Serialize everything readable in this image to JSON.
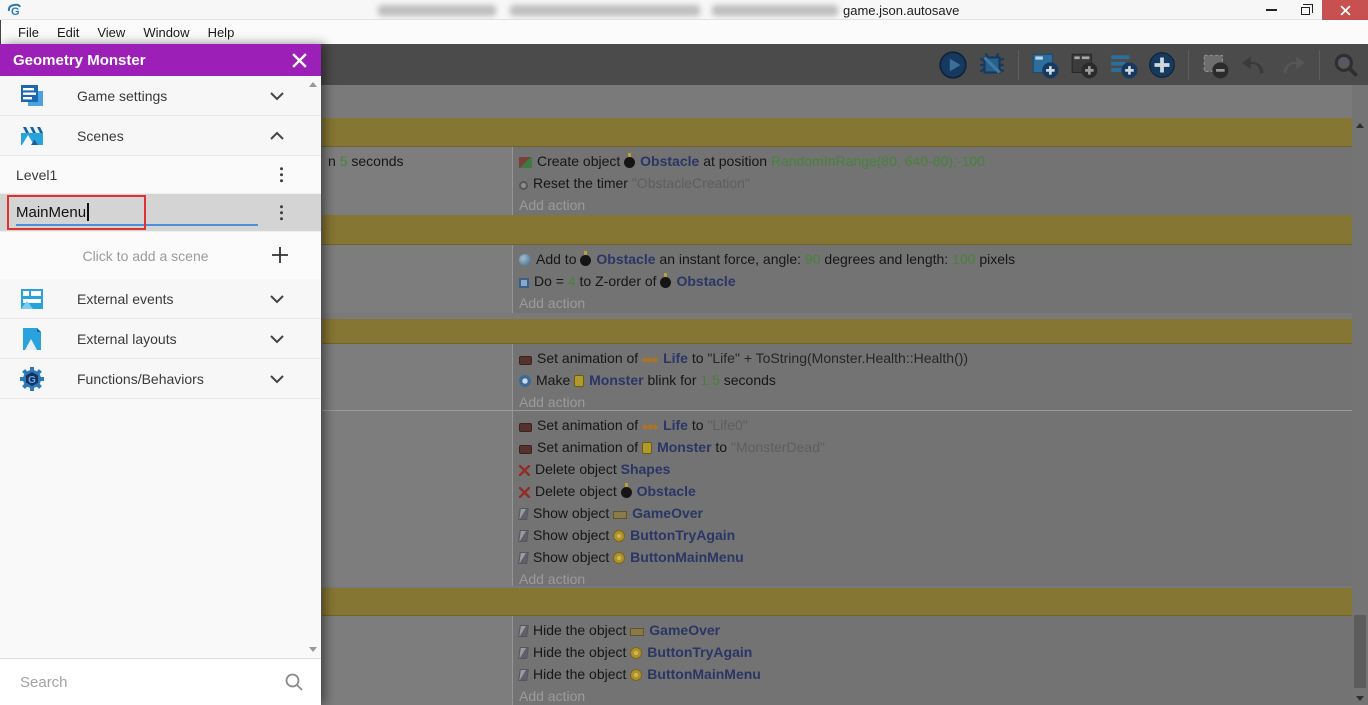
{
  "window": {
    "title": "game.json.autosave"
  },
  "menu": {
    "items": [
      "File",
      "Edit",
      "View",
      "Window",
      "Help"
    ]
  },
  "drawer": {
    "title": "Geometry Monster",
    "game_settings_label": "Game settings",
    "scenes_label": "Scenes",
    "scene_items": [
      {
        "name": "Level1"
      }
    ],
    "scene_edit_value": "MainMenu",
    "add_scene_label": "Click to add a scene",
    "external_events_label": "External events",
    "external_layouts_label": "External layouts",
    "functions_label": "Functions/Behaviors",
    "search_placeholder": "Search"
  },
  "toolbar": {
    "buttons": [
      {
        "name": "preview",
        "enabled": true
      },
      {
        "name": "debug",
        "enabled": true
      },
      {
        "name": "add-event",
        "enabled": true
      },
      {
        "name": "add-sub-event",
        "enabled": true
      },
      {
        "name": "add-comment",
        "enabled": true
      },
      {
        "name": "add-other-event",
        "enabled": true
      },
      {
        "name": "delete-event",
        "enabled": false
      },
      {
        "name": "undo",
        "enabled": false
      },
      {
        "name": "redo",
        "enabled": false
      },
      {
        "name": "search-events",
        "enabled": true
      }
    ]
  },
  "colors": {
    "accent_purple": "#9c1fb8",
    "comment_band": "#867633",
    "object_text": "#2b3566",
    "expression_text": "#47823a",
    "edit_underline": "#4a90d9",
    "annotation_red": "#df312e",
    "close_button_red": "#c75050"
  },
  "events": {
    "add_action_label": "Add action",
    "groups": [
      {
        "banner": true,
        "conditions": [
          [
            {
              "t": "p",
              "x": "n "
            },
            {
              "t": "e",
              "x": "5"
            },
            {
              "t": "p",
              "x": " seconds"
            }
          ]
        ],
        "actions": [
          [
            {
              "t": "i",
              "n": "create-object"
            },
            {
              "t": "p",
              "x": "Create object "
            },
            {
              "t": "i",
              "n": "bomb"
            },
            {
              "t": "o",
              "x": "Obstacle"
            },
            {
              "t": "p",
              "x": " at position "
            },
            {
              "t": "e",
              "x": "RandomInRange(80, 640-80);-100"
            }
          ],
          [
            {
              "t": "i",
              "n": "timer"
            },
            {
              "t": "p",
              "x": "Reset the timer "
            },
            {
              "t": "s",
              "x": "\"ObstacleCreation\""
            }
          ]
        ]
      },
      {
        "banner": true,
        "conditions": [],
        "actions": [
          [
            {
              "t": "i",
              "n": "force"
            },
            {
              "t": "p",
              "x": "Add to "
            },
            {
              "t": "i",
              "n": "bomb"
            },
            {
              "t": "o",
              "x": "Obstacle"
            },
            {
              "t": "p",
              "x": " an instant force, angle: "
            },
            {
              "t": "e",
              "x": "90"
            },
            {
              "t": "p",
              "x": " degrees and length: "
            },
            {
              "t": "e",
              "x": "100"
            },
            {
              "t": "p",
              "x": " pixels"
            }
          ],
          [
            {
              "t": "i",
              "n": "z-order"
            },
            {
              "t": "p",
              "x": "Do = "
            },
            {
              "t": "e",
              "x": "4"
            },
            {
              "t": "p",
              "x": " to Z-order of "
            },
            {
              "t": "i",
              "n": "bomb"
            },
            {
              "t": "o",
              "x": "Obstacle"
            }
          ]
        ]
      },
      {
        "banner": true,
        "conditions": [],
        "actions": [
          [
            {
              "t": "i",
              "n": "animation"
            },
            {
              "t": "p",
              "x": "Set animation of "
            },
            {
              "t": "i",
              "n": "life"
            },
            {
              "t": "o",
              "x": "Life"
            },
            {
              "t": "p",
              "x": " to "
            },
            {
              "t": "s2",
              "x": "\"Life\" + ToString(Monster.Health::Health())"
            }
          ],
          [
            {
              "t": "i",
              "n": "blink"
            },
            {
              "t": "p",
              "x": "Make "
            },
            {
              "t": "i",
              "n": "monster"
            },
            {
              "t": "o",
              "x": "Monster"
            },
            {
              "t": "p",
              "x": " blink for "
            },
            {
              "t": "e",
              "x": "1.5"
            },
            {
              "t": "p",
              "x": " seconds"
            }
          ]
        ]
      },
      {
        "banner": false,
        "conditions": [],
        "actions": [
          [
            {
              "t": "i",
              "n": "animation"
            },
            {
              "t": "p",
              "x": "Set animation of "
            },
            {
              "t": "i",
              "n": "life"
            },
            {
              "t": "o",
              "x": "Life"
            },
            {
              "t": "p",
              "x": " to "
            },
            {
              "t": "s",
              "x": "\"Life0\""
            }
          ],
          [
            {
              "t": "i",
              "n": "animation"
            },
            {
              "t": "p",
              "x": "Set animation of "
            },
            {
              "t": "i",
              "n": "monster"
            },
            {
              "t": "o",
              "x": "Monster"
            },
            {
              "t": "p",
              "x": " to "
            },
            {
              "t": "s",
              "x": "\"MonsterDead\""
            }
          ],
          [
            {
              "t": "i",
              "n": "delete"
            },
            {
              "t": "p",
              "x": "Delete object "
            },
            {
              "t": "o",
              "x": "Shapes"
            }
          ],
          [
            {
              "t": "i",
              "n": "delete"
            },
            {
              "t": "p",
              "x": "Delete object "
            },
            {
              "t": "i",
              "n": "bomb"
            },
            {
              "t": "o",
              "x": "Obstacle"
            }
          ],
          [
            {
              "t": "i",
              "n": "visibility"
            },
            {
              "t": "p",
              "x": "Show object "
            },
            {
              "t": "i",
              "n": "gameover"
            },
            {
              "t": "o",
              "x": "GameOver"
            }
          ],
          [
            {
              "t": "i",
              "n": "visibility"
            },
            {
              "t": "p",
              "x": "Show object "
            },
            {
              "t": "i",
              "n": "button"
            },
            {
              "t": "o",
              "x": "ButtonTryAgain"
            }
          ],
          [
            {
              "t": "i",
              "n": "visibility"
            },
            {
              "t": "p",
              "x": "Show object "
            },
            {
              "t": "i",
              "n": "button"
            },
            {
              "t": "o",
              "x": "ButtonMainMenu"
            }
          ]
        ]
      },
      {
        "banner": true,
        "conditions": [],
        "actions": [
          [
            {
              "t": "i",
              "n": "visibility"
            },
            {
              "t": "p",
              "x": "Hide the object "
            },
            {
              "t": "i",
              "n": "gameover"
            },
            {
              "t": "o",
              "x": "GameOver"
            }
          ],
          [
            {
              "t": "i",
              "n": "visibility"
            },
            {
              "t": "p",
              "x": "Hide the object "
            },
            {
              "t": "i",
              "n": "button"
            },
            {
              "t": "o",
              "x": "ButtonTryAgain"
            }
          ],
          [
            {
              "t": "i",
              "n": "visibility"
            },
            {
              "t": "p",
              "x": "Hide the object "
            },
            {
              "t": "i",
              "n": "button"
            },
            {
              "t": "o",
              "x": "ButtonMainMenu"
            }
          ]
        ]
      }
    ]
  }
}
